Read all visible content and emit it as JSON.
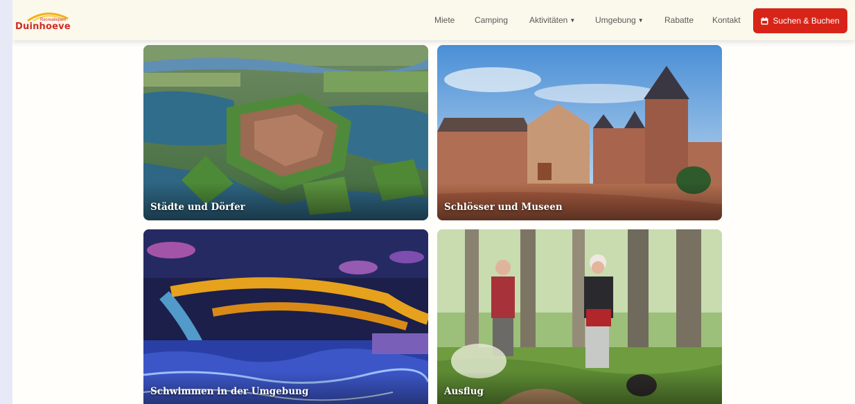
{
  "header": {
    "logo": {
      "tagline": "Recreatiepark",
      "name": "Duinhoeve"
    },
    "nav": [
      {
        "label": "Miete",
        "dropdown": false
      },
      {
        "label": "Camping",
        "dropdown": false
      },
      {
        "label": "Aktivitäten",
        "dropdown": true
      },
      {
        "label": "Umgebung",
        "dropdown": true
      },
      {
        "label": "Rabatte",
        "dropdown": false
      },
      {
        "label": "Kontakt",
        "dropdown": false
      }
    ],
    "book_button": {
      "label": "Suchen & Buchen",
      "icon": "calendar-icon"
    }
  },
  "cards": [
    {
      "label": "Städte und Dörfer"
    },
    {
      "label": "Schlösser und Museen"
    },
    {
      "label": "Schwimmen in der Umgebung"
    },
    {
      "label": "Ausflug"
    }
  ],
  "colors": {
    "brand_red": "#d82418",
    "header_bg": "#fbf8ec",
    "nav_text": "#5a5a5a"
  }
}
